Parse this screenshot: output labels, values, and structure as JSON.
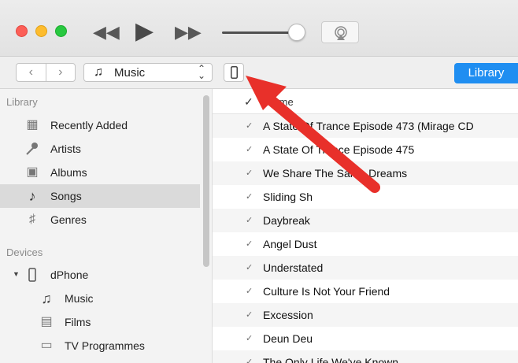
{
  "player": {
    "rewind_glyph": "◀◀",
    "play_glyph": "▶",
    "ffwd_glyph": "▶▶"
  },
  "toolbar": {
    "back_glyph": "‹",
    "forward_glyph": "›",
    "media_icon": "♫",
    "media_label": "Music",
    "media_arrows": "⌃⌄",
    "library_label": "Library"
  },
  "sidebar": {
    "library_header": "Library",
    "library_items": [
      {
        "label": "Recently Added",
        "icon": "calendar-icon",
        "glyph": "▦"
      },
      {
        "label": "Artists",
        "icon": "microphone-icon",
        "glyph": "🎤"
      },
      {
        "label": "Albums",
        "icon": "album-icon",
        "glyph": "▣"
      },
      {
        "label": "Songs",
        "icon": "note-icon",
        "glyph": "♪"
      },
      {
        "label": "Genres",
        "icon": "genres-icon",
        "glyph": "♯"
      }
    ],
    "devices_header": "Devices",
    "device": {
      "label": "dPhone",
      "disclosure": "▼"
    },
    "device_items": [
      {
        "label": "Music",
        "icon": "music-note-icon",
        "glyph": "♫"
      },
      {
        "label": "Films",
        "icon": "film-icon",
        "glyph": "▤"
      },
      {
        "label": "TV Programmes",
        "icon": "tv-icon",
        "glyph": "▭"
      }
    ]
  },
  "songs": {
    "header_check": "✓",
    "header_title": "Name",
    "row_check": "✓",
    "items": [
      "A State Of Trance Episode 473 (Mirage CD",
      "A State Of Trance Episode 475",
      "We Share The Same Dreams",
      "Sliding Sh",
      "Daybreak",
      "Angel Dust",
      "Understated",
      "Culture Is Not Your Friend",
      "Excession",
      "Deun Deu",
      "The Only Life We've Known"
    ]
  },
  "colors": {
    "accent": "#1f8ef1",
    "annotation_arrow": "#e8302a",
    "selected_row": "#dadada"
  }
}
